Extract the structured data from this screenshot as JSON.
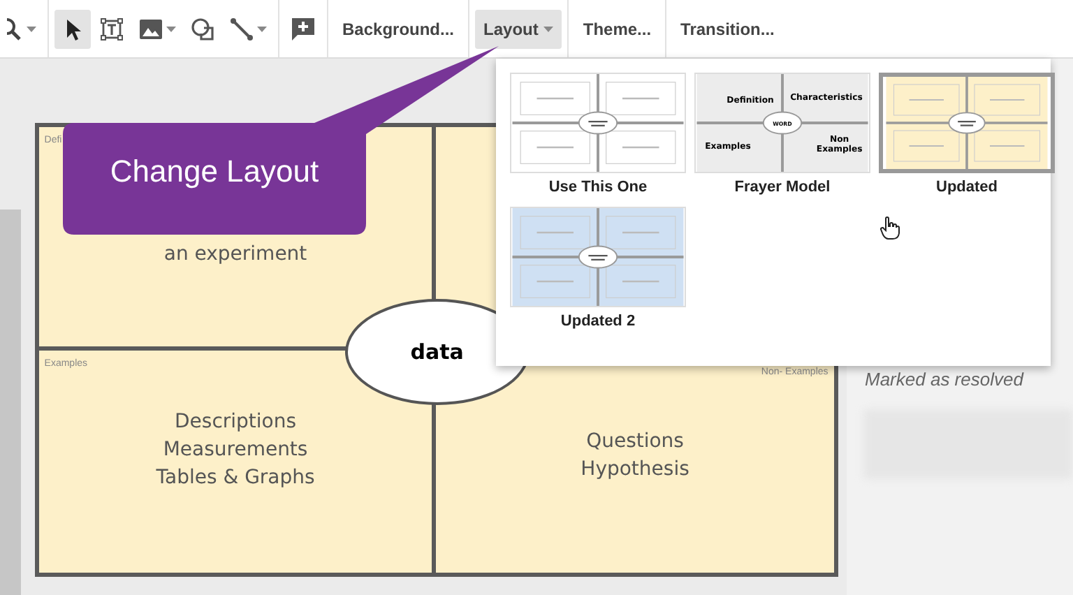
{
  "toolbar": {
    "tools": [
      {
        "kind": "zoom",
        "caret": true,
        "selected": false
      },
      {
        "kind": "select",
        "caret": false,
        "selected": true
      },
      {
        "kind": "textbox",
        "caret": false,
        "selected": false
      },
      {
        "kind": "image",
        "caret": true,
        "selected": false
      },
      {
        "kind": "shape",
        "caret": false,
        "selected": false
      },
      {
        "kind": "line",
        "caret": true,
        "selected": false
      },
      {
        "kind": "comment",
        "caret": false,
        "selected": false
      }
    ],
    "menus": [
      {
        "label": "Background...",
        "caret": false,
        "selected": false
      },
      {
        "label": "Layout",
        "caret": true,
        "selected": true
      },
      {
        "label": "Theme...",
        "caret": false,
        "selected": false
      },
      {
        "label": "Transition...",
        "caret": false,
        "selected": false
      }
    ]
  },
  "callout": {
    "text": "Change Layout"
  },
  "slide": {
    "top_left": {
      "corner_label": "Defi",
      "text": "an experiment"
    },
    "center": "data",
    "bottom_left": {
      "corner_label": "Examples",
      "text": "Descriptions\nMeasurements\nTables & Graphs"
    },
    "bottom_right": {
      "corner_label": "Non- Examples",
      "text": "Questions\nHypothesis"
    }
  },
  "comments": {
    "status": "Marked as resolved"
  },
  "layout_menu": {
    "layouts": [
      {
        "label": "Use This One",
        "kind": "placeholder",
        "color": "#ffffff",
        "selected": false
      },
      {
        "label": "Frayer Model",
        "kind": "labeled",
        "color": "#ececec",
        "selected": false,
        "center": "WORD",
        "quadrants": [
          "Definition",
          "Characteristics",
          "Examples",
          "Non\nExamples"
        ]
      },
      {
        "label": "Updated",
        "kind": "placeholder",
        "color": "#fdf0c9",
        "selected": true
      },
      {
        "label": "Updated 2",
        "kind": "placeholder",
        "color": "#cfe0f3",
        "selected": false
      }
    ]
  }
}
